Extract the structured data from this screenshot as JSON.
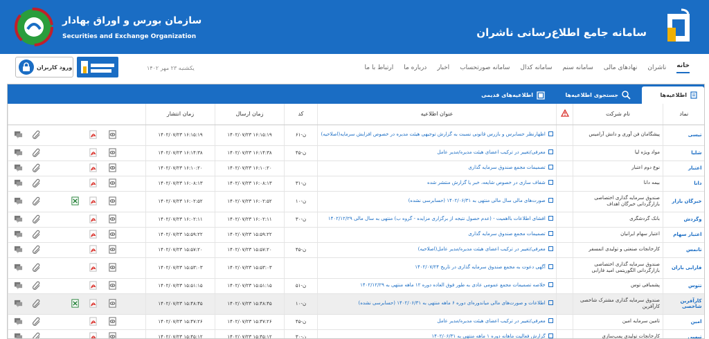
{
  "header": {
    "title": "سامانه جامع اطلاع‌رسانی ناشران",
    "org_name_fa": "سازمان بورس و اوراق بهادار",
    "org_name_en": "Securities and Exchange Organization",
    "brand_color": "#1a6dc4"
  },
  "nav": {
    "items": [
      "خانه",
      "ناشران",
      "نهادهای مالی",
      "سامانه سنم",
      "سامانه کدال",
      "سامانه صورتحساب",
      "اخبار",
      "درباره ما",
      "ارتباط با ما"
    ],
    "date": "یکشنبه ۲۳ مهر ۱۴۰۲",
    "login_label": "ورود کاربران"
  },
  "tabs": {
    "announcements": "اطلاعیه‌ها",
    "search": "جستجوی اطلاعیه‌ها",
    "old": "اطلاعیه‌های قدیمی"
  },
  "table": {
    "headers": {
      "symbol": "نماد",
      "company": "نام شرکت",
      "title": "عنوان اطلاعیه",
      "code": "کد",
      "sent": "زمان ارسال",
      "published": "زمان انتشار"
    },
    "rows": [
      {
        "symbol": "تیسی",
        "company": "پیشگامان فن آوری و دانش آرامیس",
        "title": "اظهارنظر حسابرس و بازرس قانونی نسبت به گزارش توجیهی هیئت مدیره در خصوص افزایش سرمایه(اصلاحیه)",
        "code": "ن-۶۱",
        "sent": "۱۴۰۲/۰۷/۲۳ ۱۶:۱۵:۱۹",
        "published": "۱۴۰۲/۰۷/۲۳ ۱۶:۱۵:۱۹",
        "excel": false,
        "tall": true,
        "shade": false
      },
      {
        "symbol": "شلیا",
        "company": "مواد ویژه لیا",
        "title": "معرفی/تغییر در ترکیب اعضای هیئت مدیره/مدیر عامل",
        "code": "ن-۴۵",
        "sent": "۱۴۰۲/۰۷/۲۳ ۱۶:۱۴:۳۸",
        "published": "۱۴۰۲/۰۷/۲۳ ۱۶:۱۴:۳۸",
        "excel": false,
        "tall": false,
        "shade": false
      },
      {
        "symbol": "اعتبار",
        "company": "نوع دوم اعتبار",
        "title": "تصمیمات مجمع صندوق سرمایه گذاری",
        "code": "",
        "sent": "۱۴۰۲/۰۷/۲۳ ۱۶:۱۰:۲۰",
        "published": "۱۴۰۲/۰۷/۲۳ ۱۶:۱۰:۲۰",
        "excel": false,
        "tall": false,
        "shade": false
      },
      {
        "symbol": "دانا",
        "company": "بیمه دانا",
        "title": "شفاف سازی در خصوص شایعه، خبر یا گزارش منتشر شده",
        "code": "ن-۳۱",
        "sent": "۱۴۰۲/۰۷/۲۳ ۱۶:۰۸:۱۳",
        "published": "۱۴۰۲/۰۷/۲۳ ۱۶:۰۸:۱۳",
        "excel": false,
        "tall": false,
        "shade": false
      },
      {
        "symbol": "خبرگان بازار",
        "company": "صندوق سرمایه گذاری اختصاصی بازارگردانی خبرگان اهداف",
        "title": "صورت‌های مالی سال مالی منتهی به ۱۴۰۲/۰۶/۳۱ (حسابرسی نشده)",
        "code": "ن-۱۰",
        "sent": "۱۴۰۲/۰۷/۲۳ ۱۶:۰۲:۵۲",
        "published": "۱۴۰۲/۰۷/۲۳ ۱۶:۰۲:۵۲",
        "excel": true,
        "tall": true,
        "shade": false
      },
      {
        "symbol": "وگردش",
        "company": "بانک گردشگری",
        "title": "افشای اطلاعات بااهمیت - (عدم حصول نتیجه از برگزاری مزایده - گروه ب) منتهی به سال مالی ۱۴۰۲/۱۲/۲۹",
        "code": "ن-۳۰",
        "sent": "۱۴۰۲/۰۷/۲۳ ۱۶:۰۲:۱۱",
        "published": "۱۴۰۲/۰۷/۲۳ ۱۶:۰۲:۱۱",
        "excel": false,
        "tall": false,
        "shade": false
      },
      {
        "symbol": "اعتبار سهام",
        "company": "اعتبار سهام ایرانیان",
        "title": "تصمیمات مجمع صندوق سرمایه گذاری",
        "code": "",
        "sent": "۱۴۰۲/۰۷/۲۳ ۱۵:۵۹:۲۲",
        "published": "۱۴۰۲/۰۷/۲۳ ۱۵:۵۹:۲۲",
        "excel": false,
        "tall": false,
        "shade": false
      },
      {
        "symbol": "تانمس",
        "company": "کارخانجات صنعتی و تولیدی اتمسفر",
        "title": "معرفی/تغییر در ترکیب اعضای هیئت مدیره/مدیر عامل(اصلاحیه)",
        "code": "ن-۴۵",
        "sent": "۱۴۰۲/۰۷/۲۳ ۱۵:۵۷:۲۰",
        "published": "۱۴۰۲/۰۷/۲۳ ۱۵:۵۷:۲۰",
        "excel": false,
        "tall": false,
        "shade": false
      },
      {
        "symbol": "فارابی باران",
        "company": "صندوق سرمایه گذاری اختصاصی بازارگردانی الگوریتمی امید فارابی",
        "title": "آگهی دعوت به مجمع صندوق سرمایه گذاری در تاریخ ۱۴۰۲/۰۷/۲۴",
        "code": "",
        "sent": "۱۴۰۲/۰۷/۲۳ ۱۵:۵۳:۰۳",
        "published": "۱۴۰۲/۰۷/۲۳ ۱۵:۵۳:۰۳",
        "excel": false,
        "tall": true,
        "shade": false
      },
      {
        "symbol": "تتوس",
        "company": "پشمبافی توس",
        "title": "خلاصه تصمیمات مجمع عمومی عادی به طور فوق العاده دوره ۱۲ ماهه منتهی به ۱۴۰۲/۱۲/۲۹",
        "code": "ن-۵۱",
        "sent": "۱۴۰۲/۰۷/۲۳ ۱۵:۵۱:۱۵",
        "published": "۱۴۰۲/۰۷/۲۳ ۱۵:۵۱:۱۵",
        "excel": false,
        "tall": false,
        "shade": false
      },
      {
        "symbol": "کارآفرین شاخصی",
        "company": "صندوق سرمایه گذاری مشترک شاخصی کارآفرین",
        "title": "اطلاعات و صورت‌های مالی میاندوره‌ای دوره ۶ ماهه منتهی به ۱۴۰۲/۰۶/۳۱ (حسابرسی نشده)",
        "code": "ن-۱۰",
        "sent": "۱۴۰۲/۰۷/۲۳ ۱۵:۴۸:۴۵",
        "published": "۱۴۰۲/۰۷/۲۳ ۱۵:۴۸:۴۵",
        "excel": true,
        "tall": true,
        "shade": true
      },
      {
        "symbol": "امین",
        "company": "تامین سرمایه امین",
        "title": "معرفی/تغییر در ترکیب اعضای هیئت مدیره/مدیر عامل",
        "code": "ن-۴۵",
        "sent": "۱۴۰۲/۰۷/۲۳ ۱۵:۴۷:۲۶",
        "published": "۱۴۰۲/۰۷/۲۳ ۱۵:۴۷:۲۶",
        "excel": false,
        "tall": false,
        "shade": false
      },
      {
        "symbol": "تپمپی",
        "company": "کارخانجات تولیدی پمپ‌سازی",
        "title": "گزارش فعالیت ماهانه دوره ۱ ماهه منتهی به ۱۴۰۲/۰۶/۳۱",
        "code": "ن-۳۰",
        "sent": "۱۴۰۲/۰۷/۲۳ ۱۵:۴۵:۱۲",
        "published": "۱۴۰۲/۰۷/۲۳ ۱۵:۴۵:۱۲",
        "excel": false,
        "tall": false,
        "shade": false
      }
    ]
  }
}
